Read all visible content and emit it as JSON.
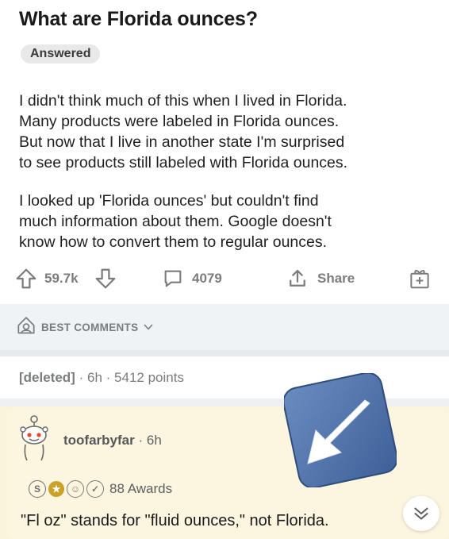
{
  "post": {
    "title": "What are Florida ounces?",
    "badge": "Answered",
    "paragraph_1": "I didn't think much of this when I lived in Florida.\nMany products were labeled in Florida ounces.\nBut now that I live in another state I'm surprised\nto see products still labeled with Florida ounces.",
    "paragraph_2": "I looked up 'Florida ounces' but couldn't find\nmuch information about them. Google doesn't\nknow how to convert them to regular ounces."
  },
  "actions": {
    "votes": "59.7k",
    "comments": "4079",
    "share_label": "Share"
  },
  "comments_header": {
    "sort_label": "BEST COMMENTS"
  },
  "deleted_comment": {
    "author": "[deleted]",
    "separator": "·",
    "age": "6h",
    "points": "5412 points"
  },
  "top_comment": {
    "author": "toofarbyfar",
    "separator": "·",
    "age": "6h",
    "awards": "88 Awards",
    "text": "\"Fl oz\" stands for \"fluid ounces,\" not Florida."
  },
  "colors": {
    "accent_blue": "#4a6fa5",
    "comment_bg": "#fcf6e0",
    "meta_gray": "#7a7c7e"
  },
  "icons": [
    "upvote-icon",
    "downvote-icon",
    "comment-icon",
    "share-icon",
    "award-add-icon",
    "shield-icon",
    "chevron-down-icon",
    "snoo-avatar-icon",
    "collapse-icon",
    "down-left-arrow-icon"
  ]
}
